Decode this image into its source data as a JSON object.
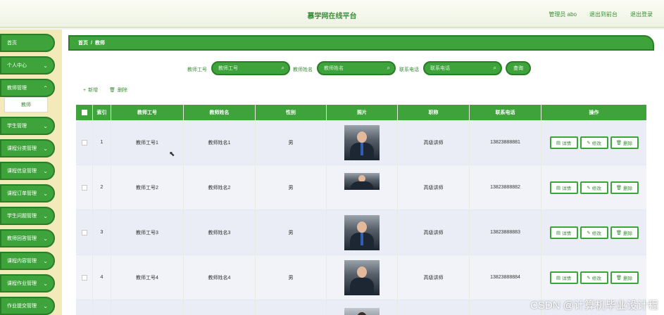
{
  "header": {
    "title": "慕学网在线平台",
    "admin": "管理员 abo",
    "back_to_front": "退出到前台",
    "logout": "退出登录"
  },
  "sidebar": {
    "items": [
      {
        "label": "首页",
        "chevron": false
      },
      {
        "label": "个人中心",
        "chevron": true
      },
      {
        "label": "教师管理",
        "chevron": true
      },
      {
        "label": "学生管理",
        "chevron": true
      },
      {
        "label": "课程分类管理",
        "chevron": true
      },
      {
        "label": "课程信息管理",
        "chevron": true
      },
      {
        "label": "课程订单管理",
        "chevron": true
      },
      {
        "label": "学生问题管理",
        "chevron": true
      },
      {
        "label": "教师回答管理",
        "chevron": true
      },
      {
        "label": "课程内容管理",
        "chevron": true
      },
      {
        "label": "课程作业管理",
        "chevron": true
      },
      {
        "label": "作业提交管理",
        "chevron": true
      }
    ],
    "submenu": "教师"
  },
  "breadcrumb": {
    "home": "首页",
    "sep": "/",
    "current": "教师"
  },
  "search": {
    "fields": [
      {
        "label": "教师工号",
        "placeholder": "教师工号"
      },
      {
        "label": "教师姓名",
        "placeholder": "教师姓名"
      },
      {
        "label": "联系电话",
        "placeholder": "联系电话"
      }
    ],
    "button": "查询"
  },
  "toolbar": {
    "add": "新增",
    "delete": "删除"
  },
  "table": {
    "headers": [
      "",
      "索引",
      "教师工号",
      "教师姓名",
      "性别",
      "照片",
      "职称",
      "联系电话",
      "操作"
    ],
    "rows": [
      {
        "index": "1",
        "id": "教师工号1",
        "name": "教师姓名1",
        "gender": "男",
        "title": "高级讲师",
        "phone": "13823888881"
      },
      {
        "index": "2",
        "id": "教师工号2",
        "name": "教师姓名2",
        "gender": "男",
        "title": "高级讲师",
        "phone": "13823888882"
      },
      {
        "index": "3",
        "id": "教师工号3",
        "name": "教师姓名3",
        "gender": "男",
        "title": "高级讲师",
        "phone": "13823888883"
      },
      {
        "index": "4",
        "id": "教师工号4",
        "name": "教师姓名4",
        "gender": "男",
        "title": "高级讲师",
        "phone": "13823888884"
      }
    ],
    "ops": {
      "detail": "详情",
      "edit": "修改",
      "delete": "删除"
    }
  },
  "watermark": "CSDN @计算机毕业设计程",
  "colors": {
    "primary": "#3da33a",
    "primary_dark": "#2b7d28",
    "sidebar_bg": "#f4e9b9"
  }
}
